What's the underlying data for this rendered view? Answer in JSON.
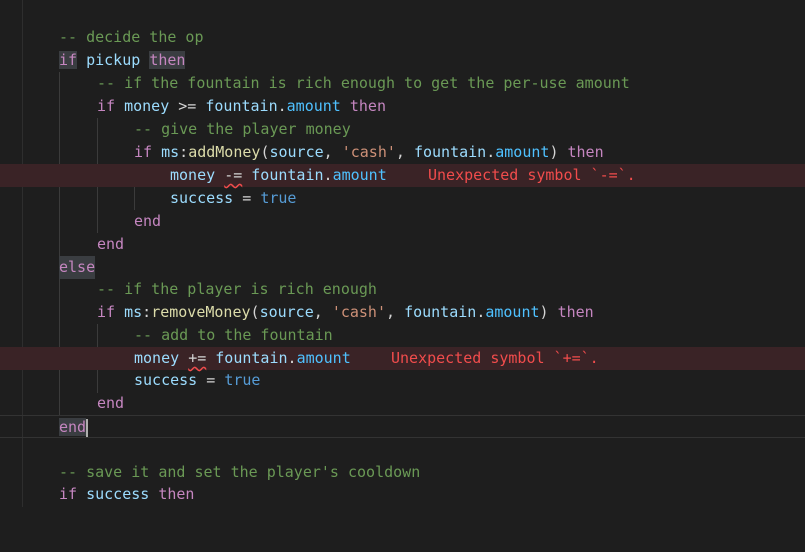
{
  "lines": {
    "l0": {
      "cmt": "-- decide the op"
    },
    "l1": {
      "kw1": "if",
      "var": "pickup",
      "kw2": "then"
    },
    "l2": {
      "cmt": "-- if the fountain is rich enough to get the per-use amount"
    },
    "l3": {
      "kw1": "if",
      "v1": "money",
      "op": ">=",
      "v2": "fountain",
      "dot": ".",
      "prop": "amount",
      "kw2": "then"
    },
    "l4": {
      "cmt": "-- give the player money"
    },
    "l5": {
      "kw1": "if",
      "v1": "ms",
      "colon": ":",
      "fn": "addMoney",
      "p1": "(",
      "v2": "source",
      "c1": ", ",
      "str": "'cash'",
      "c2": ", ",
      "v3": "fountain",
      "dot": ".",
      "prop": "amount",
      "p2": ")",
      "kw2": "then"
    },
    "l6": {
      "v1": "money",
      "op": "-=",
      "v2": "fountain",
      "dot": ".",
      "prop": "amount",
      "err": "Unexpected symbol `-=`."
    },
    "l7": {
      "v1": "success",
      "op": "=",
      "bool": "true"
    },
    "l8": {
      "kw": "end"
    },
    "l9": {
      "kw": "end"
    },
    "l10": {
      "kw": "else"
    },
    "l11": {
      "cmt": "-- if the player is rich enough"
    },
    "l12": {
      "kw1": "if",
      "v1": "ms",
      "colon": ":",
      "fn": "removeMoney",
      "p1": "(",
      "v2": "source",
      "c1": ", ",
      "str": "'cash'",
      "c2": ", ",
      "v3": "fountain",
      "dot": ".",
      "prop": "amount",
      "p2": ")",
      "kw2": "then"
    },
    "l13": {
      "cmt": "-- add to the fountain"
    },
    "l14": {
      "v1": "money",
      "op": "+=",
      "v2": "fountain",
      "dot": ".",
      "prop": "amount",
      "err": "Unexpected symbol `+=`."
    },
    "l15": {
      "v1": "success",
      "op": "=",
      "bool": "true"
    },
    "l16": {
      "kw": "end"
    },
    "l17": {
      "kw": "end"
    },
    "l18": {
      "cmt": "-- save it and set the player's cooldown"
    },
    "l19": {
      "kw1": "if",
      "var": "success",
      "kw2": "then"
    }
  },
  "colors": {
    "background": "#1e1e1e",
    "keyword": "#c586c0",
    "variable": "#9cdcfe",
    "function": "#dcdcaa",
    "property": "#4fc1ff",
    "string": "#ce9178",
    "comment": "#6a9955",
    "error": "#f14c4c"
  }
}
